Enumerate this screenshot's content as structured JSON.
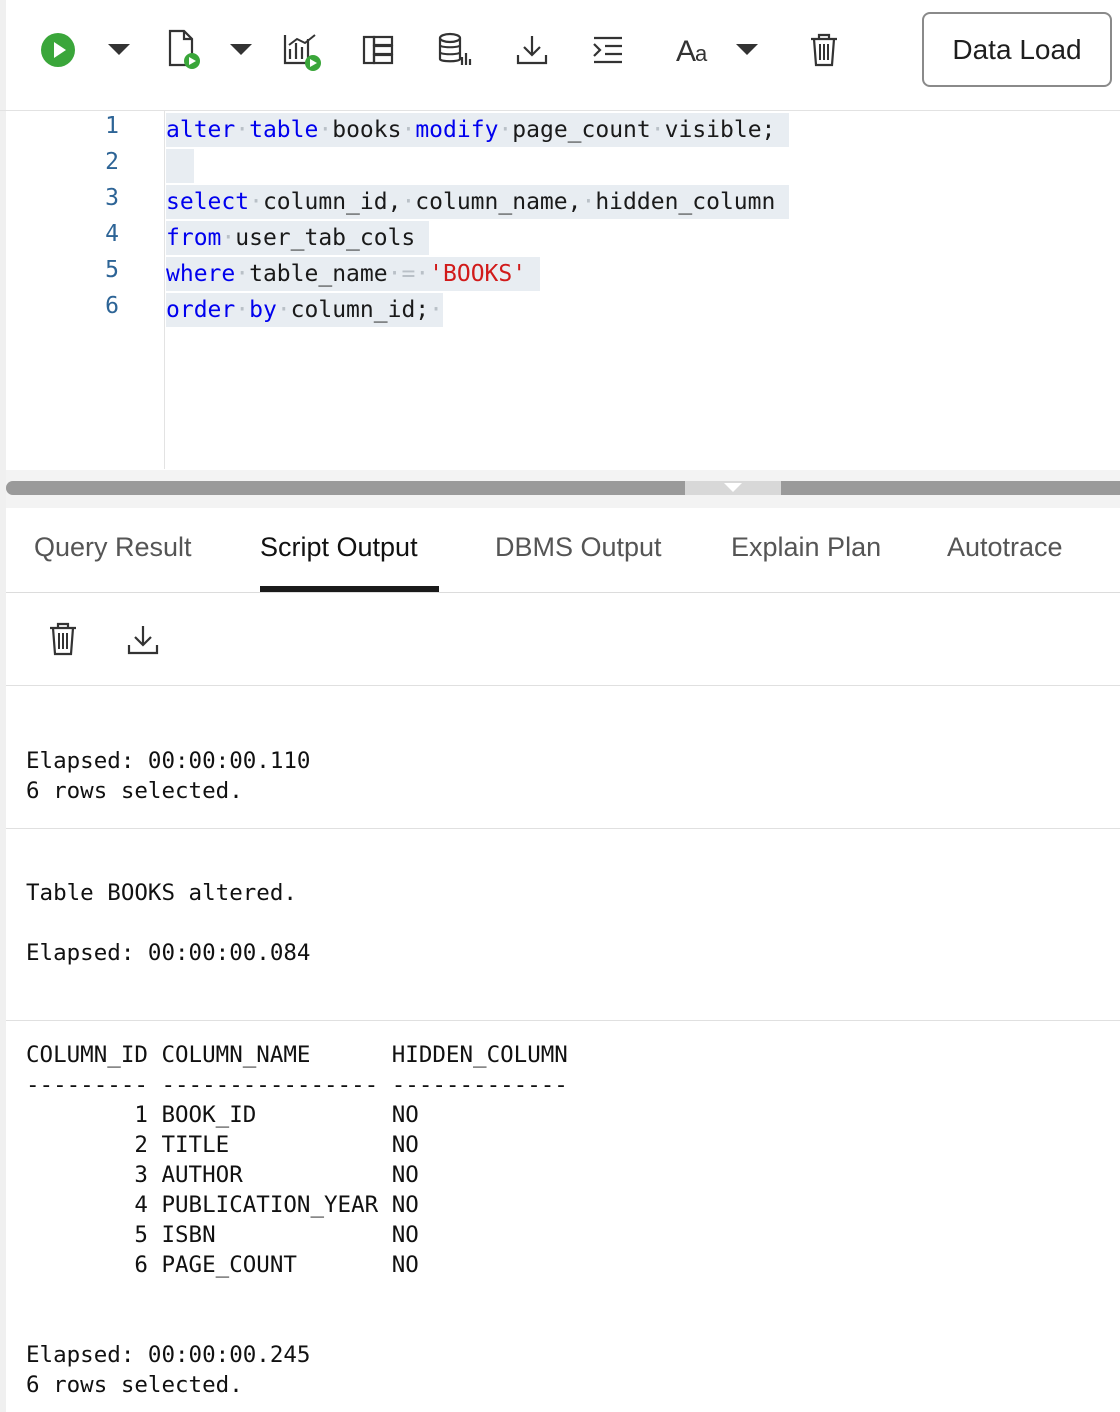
{
  "toolbar": {
    "icons": [
      "run-icon",
      "dropdown-arrow-icon",
      "run-script-icon",
      "dropdown-arrow-icon",
      "explain-plan-icon",
      "autotrace-icon",
      "database-icon",
      "download-icon",
      "format-icon",
      "font-icon",
      "dropdown-arrow-icon",
      "trash-icon"
    ],
    "data_load_label": "Data Load",
    "accent": "#3aa63a"
  },
  "editor": {
    "line_numbers": [
      "1",
      "2",
      "3",
      "4",
      "5",
      "6"
    ],
    "lines": [
      [
        {
          "t": "alter",
          "c": "kw"
        },
        {
          "t": "·",
          "c": "ws"
        },
        {
          "t": "table",
          "c": "kw"
        },
        {
          "t": "·",
          "c": "ws"
        },
        {
          "t": "books",
          "c": ""
        },
        {
          "t": "·",
          "c": "ws"
        },
        {
          "t": "modify",
          "c": "kw"
        },
        {
          "t": "·",
          "c": "ws"
        },
        {
          "t": "page_count",
          "c": ""
        },
        {
          "t": "·",
          "c": "ws"
        },
        {
          "t": "visible;",
          "c": ""
        },
        {
          "t": " ",
          "c": ""
        }
      ],
      [],
      [
        {
          "t": "select",
          "c": "kw"
        },
        {
          "t": "·",
          "c": "ws"
        },
        {
          "t": "column_id,",
          "c": ""
        },
        {
          "t": "·",
          "c": "ws"
        },
        {
          "t": "column_name,",
          "c": ""
        },
        {
          "t": "·",
          "c": "ws"
        },
        {
          "t": "hidden_column",
          "c": ""
        },
        {
          "t": " ",
          "c": ""
        }
      ],
      [
        {
          "t": "from",
          "c": "kw"
        },
        {
          "t": "·",
          "c": "ws"
        },
        {
          "t": "user_tab_cols",
          "c": ""
        },
        {
          "t": " ",
          "c": ""
        }
      ],
      [
        {
          "t": "where",
          "c": "kw"
        },
        {
          "t": "·",
          "c": "ws"
        },
        {
          "t": "table_name",
          "c": ""
        },
        {
          "t": "·",
          "c": "ws"
        },
        {
          "t": "=",
          "c": "ws"
        },
        {
          "t": "·",
          "c": "ws"
        },
        {
          "t": "'BOOKS'",
          "c": "str"
        },
        {
          "t": " ",
          "c": ""
        }
      ],
      [
        {
          "t": "order",
          "c": "kw"
        },
        {
          "t": "·",
          "c": "ws"
        },
        {
          "t": "by",
          "c": "kw"
        },
        {
          "t": "·",
          "c": "ws"
        },
        {
          "t": "column_id;",
          "c": ""
        },
        {
          "t": "·",
          "c": "ws"
        }
      ]
    ]
  },
  "tabs": [
    "Query Result",
    "Script Output",
    "DBMS Output",
    "Explain Plan",
    "Autotrace"
  ],
  "active_tab": "Script Output",
  "output_toolbar": {
    "icons": [
      "trash-icon",
      "download-icon"
    ]
  },
  "output": {
    "block1": {
      "elapsed": "Elapsed: 00:00:00.110",
      "rows": "6 rows selected."
    },
    "block2": {
      "message": "Table BOOKS altered.",
      "elapsed": "Elapsed: 00:00:00.084"
    },
    "block3": {
      "header": "COLUMN_ID COLUMN_NAME      HIDDEN_COLUMN",
      "separator": "--------- ---------------- -------------",
      "rows": [
        "        1 BOOK_ID          NO",
        "        2 TITLE            NO",
        "        3 AUTHOR           NO",
        "        4 PUBLICATION_YEAR NO",
        "        5 ISBN             NO",
        "        6 PAGE_COUNT       NO"
      ],
      "elapsed": "Elapsed: 00:00:00.245",
      "rows_selected": "6 rows selected."
    }
  }
}
